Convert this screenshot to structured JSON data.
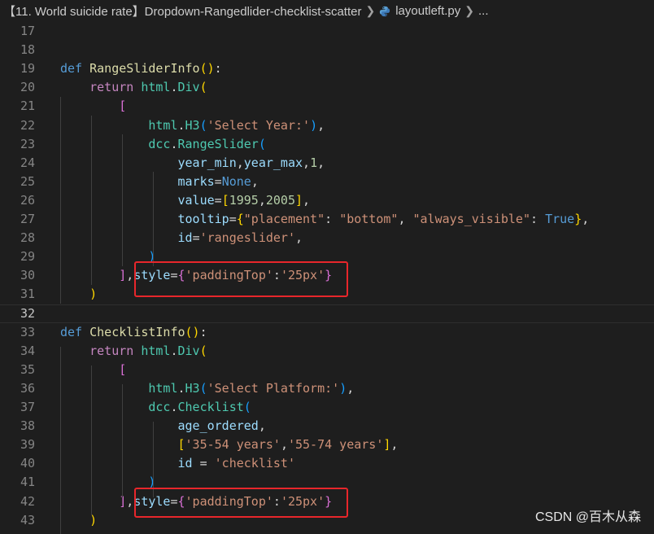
{
  "breadcrumb": {
    "folder": "【11. World suicide rate】Dropdown-Rangedlider-checklist-scatter",
    "file": "layoutleft.py",
    "ellipsis": "..."
  },
  "watermark": "CSDN @百木从森",
  "lines": [
    {
      "n": "17",
      "tokens": []
    },
    {
      "n": "18",
      "tokens": []
    },
    {
      "n": "19",
      "tokens": [
        [
          "def",
          "kw"
        ],
        [
          " ",
          "txt"
        ],
        [
          "RangeSliderInfo",
          "fn"
        ],
        [
          "()",
          "b1"
        ],
        [
          ":",
          "txt"
        ]
      ]
    },
    {
      "n": "20",
      "tokens": [
        [
          "    ",
          "txt"
        ],
        [
          "return",
          "ctrl"
        ],
        [
          " ",
          "txt"
        ],
        [
          "html",
          "cls"
        ],
        [
          ".",
          "txt"
        ],
        [
          "Div",
          "cls"
        ],
        [
          "(",
          "b1"
        ]
      ]
    },
    {
      "n": "21",
      "tokens": [
        [
          "        ",
          "txt"
        ],
        [
          "[",
          "b2"
        ]
      ]
    },
    {
      "n": "22",
      "tokens": [
        [
          "            ",
          "txt"
        ],
        [
          "html",
          "cls"
        ],
        [
          ".",
          "txt"
        ],
        [
          "H3",
          "cls"
        ],
        [
          "(",
          "b3"
        ],
        [
          "'Select Year:'",
          "str"
        ],
        [
          ")",
          "b3"
        ],
        [
          ",",
          "txt"
        ]
      ]
    },
    {
      "n": "23",
      "tokens": [
        [
          "            ",
          "txt"
        ],
        [
          "dcc",
          "cls"
        ],
        [
          ".",
          "txt"
        ],
        [
          "RangeSlider",
          "cls"
        ],
        [
          "(",
          "b3"
        ]
      ]
    },
    {
      "n": "24",
      "tokens": [
        [
          "                ",
          "txt"
        ],
        [
          "year_min",
          "var"
        ],
        [
          ",",
          "txt"
        ],
        [
          "year_max",
          "var"
        ],
        [
          ",",
          "txt"
        ],
        [
          "1",
          "num"
        ],
        [
          ",",
          "txt"
        ]
      ]
    },
    {
      "n": "25",
      "tokens": [
        [
          "                ",
          "txt"
        ],
        [
          "marks",
          "var"
        ],
        [
          "=",
          "txt"
        ],
        [
          "None",
          "kw"
        ],
        [
          ",",
          "txt"
        ]
      ]
    },
    {
      "n": "26",
      "tokens": [
        [
          "                ",
          "txt"
        ],
        [
          "value",
          "var"
        ],
        [
          "=",
          "txt"
        ],
        [
          "[",
          "b1"
        ],
        [
          "1995",
          "num"
        ],
        [
          ",",
          "txt"
        ],
        [
          "2005",
          "num"
        ],
        [
          "]",
          "b1"
        ],
        [
          ",",
          "txt"
        ]
      ]
    },
    {
      "n": "27",
      "tokens": [
        [
          "                ",
          "txt"
        ],
        [
          "tooltip",
          "var"
        ],
        [
          "=",
          "txt"
        ],
        [
          "{",
          "b1"
        ],
        [
          "\"placement\"",
          "str"
        ],
        [
          ": ",
          "txt"
        ],
        [
          "\"bottom\"",
          "str"
        ],
        [
          ", ",
          "txt"
        ],
        [
          "\"always_visible\"",
          "str"
        ],
        [
          ": ",
          "txt"
        ],
        [
          "True",
          "kw"
        ],
        [
          "}",
          "b1"
        ],
        [
          ",",
          "txt"
        ]
      ]
    },
    {
      "n": "28",
      "tokens": [
        [
          "                ",
          "txt"
        ],
        [
          "id",
          "var"
        ],
        [
          "=",
          "txt"
        ],
        [
          "'rangeslider'",
          "str"
        ],
        [
          ",",
          "txt"
        ]
      ]
    },
    {
      "n": "29",
      "tokens": [
        [
          "            ",
          "txt"
        ],
        [
          ")",
          "b3"
        ]
      ]
    },
    {
      "n": "30",
      "tokens": [
        [
          "        ",
          "txt"
        ],
        [
          "]",
          "b2"
        ],
        [
          ",",
          "txt"
        ],
        [
          "style",
          "var"
        ],
        [
          "=",
          "txt"
        ],
        [
          "{",
          "b2"
        ],
        [
          "'paddingTop'",
          "str"
        ],
        [
          ":",
          "txt"
        ],
        [
          "'25px'",
          "str"
        ],
        [
          "}",
          "b2"
        ]
      ]
    },
    {
      "n": "31",
      "tokens": [
        [
          "    ",
          "txt"
        ],
        [
          ")",
          "b1"
        ]
      ]
    },
    {
      "n": "32",
      "tokens": []
    },
    {
      "n": "33",
      "tokens": [
        [
          "def",
          "kw"
        ],
        [
          " ",
          "txt"
        ],
        [
          "ChecklistInfo",
          "fn"
        ],
        [
          "()",
          "b1"
        ],
        [
          ":",
          "txt"
        ]
      ]
    },
    {
      "n": "34",
      "tokens": [
        [
          "    ",
          "txt"
        ],
        [
          "return",
          "ctrl"
        ],
        [
          " ",
          "txt"
        ],
        [
          "html",
          "cls"
        ],
        [
          ".",
          "txt"
        ],
        [
          "Div",
          "cls"
        ],
        [
          "(",
          "b1"
        ]
      ]
    },
    {
      "n": "35",
      "tokens": [
        [
          "        ",
          "txt"
        ],
        [
          "[",
          "b2"
        ]
      ]
    },
    {
      "n": "36",
      "tokens": [
        [
          "            ",
          "txt"
        ],
        [
          "html",
          "cls"
        ],
        [
          ".",
          "txt"
        ],
        [
          "H3",
          "cls"
        ],
        [
          "(",
          "b3"
        ],
        [
          "'Select Platform:'",
          "str"
        ],
        [
          ")",
          "b3"
        ],
        [
          ",",
          "txt"
        ]
      ]
    },
    {
      "n": "37",
      "tokens": [
        [
          "            ",
          "txt"
        ],
        [
          "dcc",
          "cls"
        ],
        [
          ".",
          "txt"
        ],
        [
          "Checklist",
          "cls"
        ],
        [
          "(",
          "b3"
        ]
      ]
    },
    {
      "n": "38",
      "tokens": [
        [
          "                ",
          "txt"
        ],
        [
          "age_ordered",
          "var"
        ],
        [
          ",",
          "txt"
        ]
      ]
    },
    {
      "n": "39",
      "tokens": [
        [
          "                ",
          "txt"
        ],
        [
          "[",
          "b1"
        ],
        [
          "'35-54 years'",
          "str"
        ],
        [
          ",",
          "txt"
        ],
        [
          "'55-74 years'",
          "str"
        ],
        [
          "]",
          "b1"
        ],
        [
          ",",
          "txt"
        ]
      ]
    },
    {
      "n": "40",
      "tokens": [
        [
          "                ",
          "txt"
        ],
        [
          "id",
          "var"
        ],
        [
          " = ",
          "txt"
        ],
        [
          "'checklist'",
          "str"
        ]
      ]
    },
    {
      "n": "41",
      "tokens": [
        [
          "            ",
          "txt"
        ],
        [
          ")",
          "b3"
        ]
      ]
    },
    {
      "n": "42",
      "tokens": [
        [
          "        ",
          "txt"
        ],
        [
          "]",
          "b2"
        ],
        [
          ",",
          "txt"
        ],
        [
          "style",
          "var"
        ],
        [
          "=",
          "txt"
        ],
        [
          "{",
          "b2"
        ],
        [
          "'paddingTop'",
          "str"
        ],
        [
          ":",
          "txt"
        ],
        [
          "'25px'",
          "str"
        ],
        [
          "}",
          "b2"
        ]
      ]
    },
    {
      "n": "43",
      "tokens": [
        [
          "    ",
          "txt"
        ],
        [
          ")",
          "b1"
        ]
      ]
    }
  ]
}
